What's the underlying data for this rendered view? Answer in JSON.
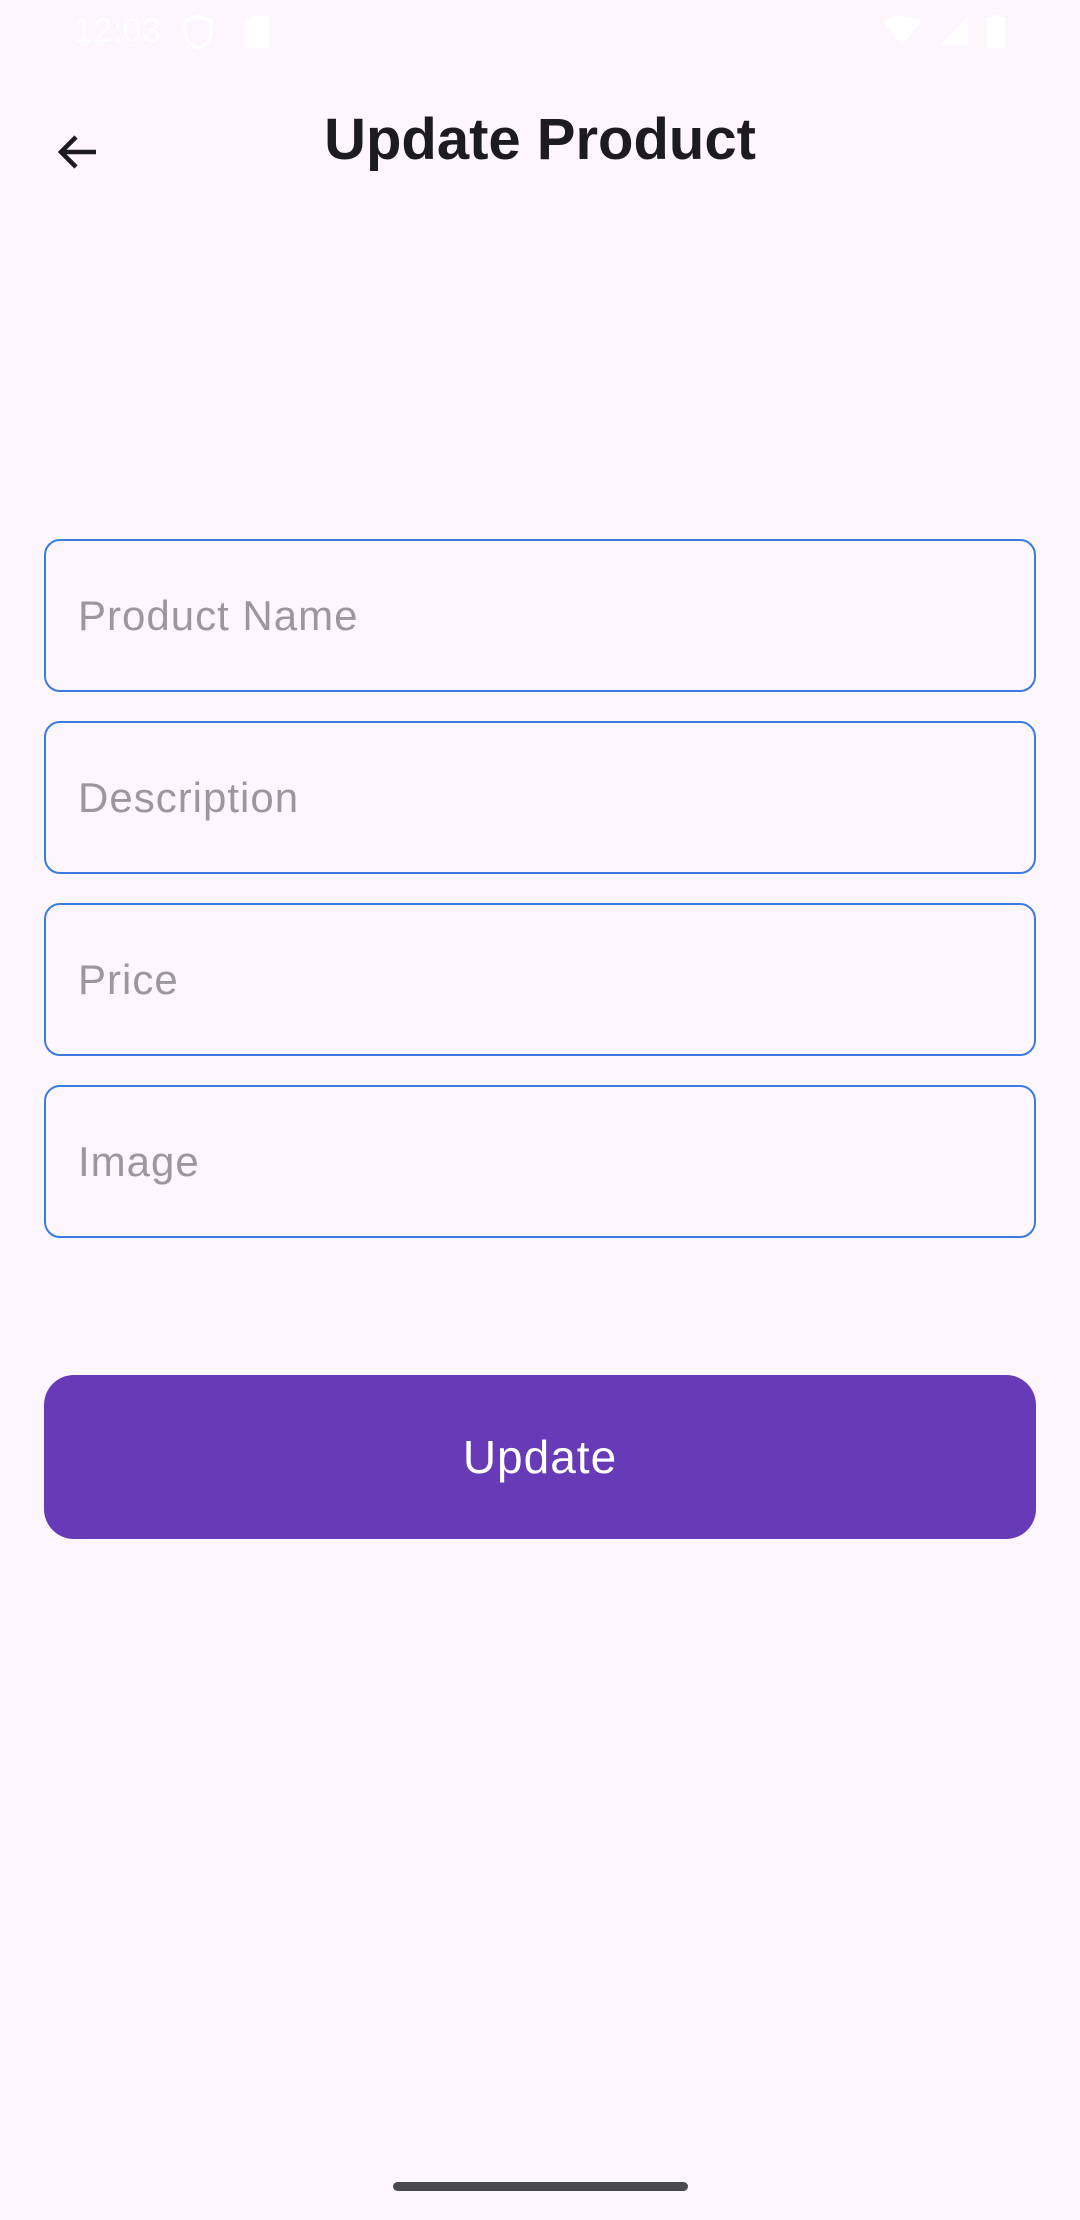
{
  "status_bar": {
    "time": "12:03",
    "icons": [
      "shield-icon",
      "sd-card-icon",
      "wifi-icon",
      "cellular-signal-icon",
      "battery-icon"
    ]
  },
  "header": {
    "title": "Update Product",
    "back_icon": "arrow-back-icon"
  },
  "form": {
    "fields": [
      {
        "name": "product-name",
        "placeholder": "Product Name",
        "value": ""
      },
      {
        "name": "description",
        "placeholder": "Description",
        "value": ""
      },
      {
        "name": "price",
        "placeholder": "Price",
        "value": ""
      },
      {
        "name": "image",
        "placeholder": "Image",
        "value": ""
      }
    ],
    "submit_label": "Update"
  },
  "colors": {
    "background": "#fdf6fd",
    "field_border": "#3a7be0",
    "button": "#673ab7",
    "button_text": "#ffffff",
    "placeholder": "#9a979e"
  }
}
